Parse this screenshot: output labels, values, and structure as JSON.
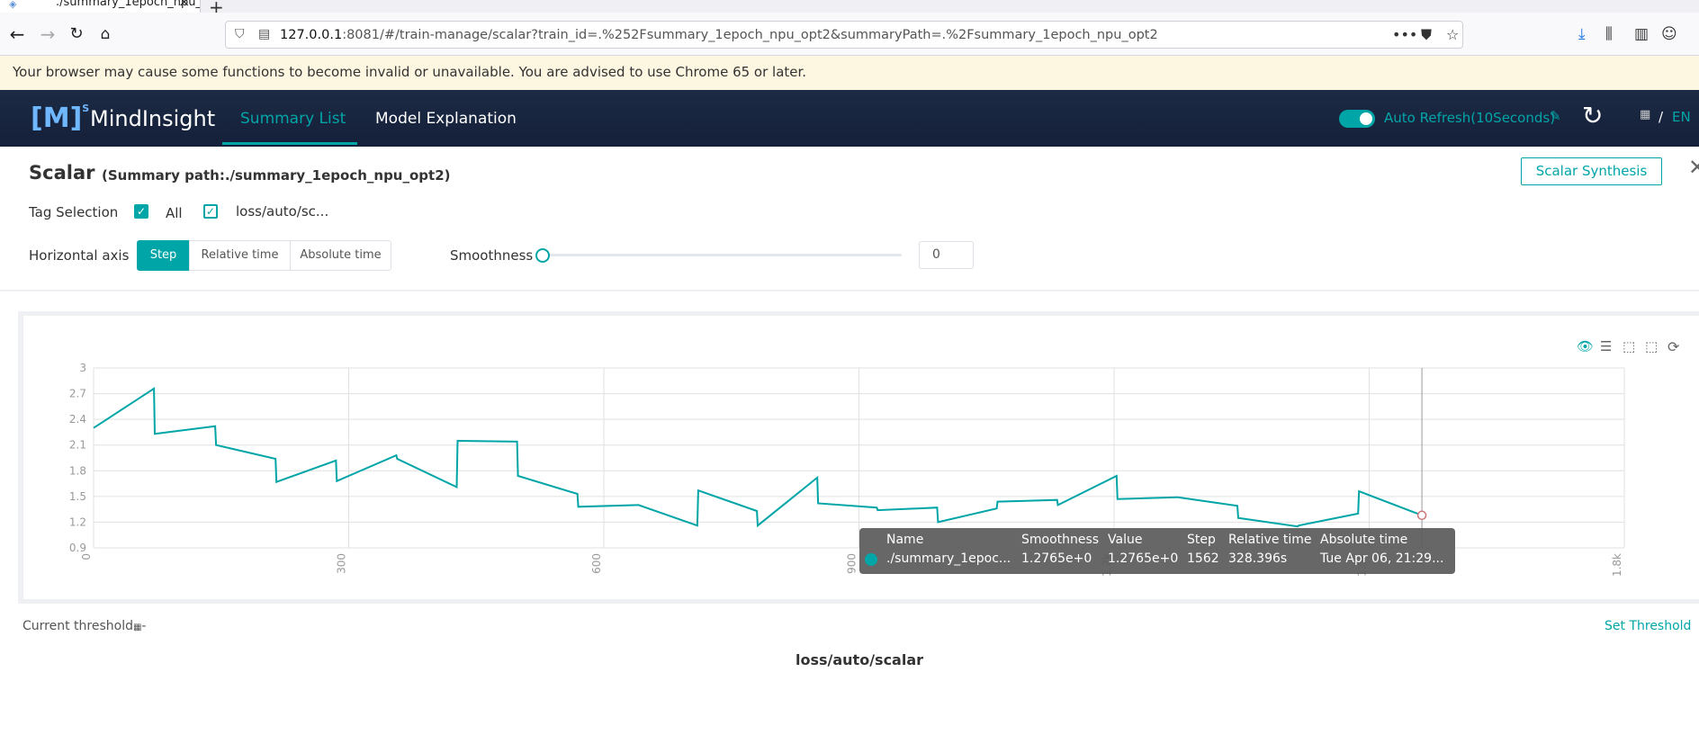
{
  "browser": {
    "tab_title": "./summary_1epoch_npu_...",
    "url_host": "127.0.0.1",
    "url_rest": ":8081/#/train-manage/scalar?train_id=.%252Fsummary_1epoch_npu_opt2&summaryPath=.%2Fsummary_1epoch_npu_opt2",
    "warning": "Your browser may cause some functions to become invalid or unavailable. You are advised to use Chrome 65 or later."
  },
  "header": {
    "logo_mark": "[M]",
    "logo_sup": "S",
    "logo_text": "MindInsight",
    "nav": [
      "Summary List",
      "Model Explanation"
    ],
    "auto_refresh": "Auto Refresh(10Seconds)",
    "lang": "EN",
    "lang_sep": "/"
  },
  "scalar": {
    "title": "Scalar",
    "summary_path": "(Summary path:./summary_1epoch_npu_opt2)",
    "synthesis_button": "Scalar Synthesis",
    "tag_selection_label": "Tag Selection",
    "tag_all": "All",
    "tag_item": "loss/auto/sc...",
    "horizontal_axis_label": "Horizontal axis",
    "axis_options": [
      "Step",
      "Relative time",
      "Absolute time"
    ],
    "selected_axis": "Step",
    "smoothness_label": "Smoothness",
    "smoothness_value": "0",
    "threshold_label": "Current threshold",
    "threshold_value": "-",
    "set_threshold": "Set Threshold",
    "chart_tag": "loss/auto/scalar"
  },
  "tooltip": {
    "headers": [
      "Name",
      "Smoothness",
      "Value",
      "Step",
      "Relative time",
      "Absolute time"
    ],
    "row": [
      "./summary_1epoc...",
      "1.2765e+0",
      "1.2765e+0",
      "1562",
      "328.396s",
      "Tue Apr 06, 21:29..."
    ]
  },
  "chart_data": {
    "type": "line",
    "xlabel": "",
    "ylabel": "",
    "xlim": [
      0,
      1800
    ],
    "ylim": [
      0.9,
      3
    ],
    "x_ticks": [
      "0",
      "300",
      "600",
      "900",
      "1.2k",
      "1.5k",
      "1.8k"
    ],
    "y_ticks": [
      "0.9",
      "1.2",
      "1.5",
      "1.8",
      "2.1",
      "2.4",
      "2.7",
      "3"
    ],
    "line_color": "#00a5a7",
    "series": [
      {
        "x": [
          0,
          71,
          72,
          143,
          144,
          214,
          215,
          285,
          286,
          356,
          357,
          427,
          428,
          498,
          499,
          569,
          570,
          640,
          641,
          710,
          711,
          780,
          781,
          851,
          852,
          921,
          922,
          992,
          993,
          1062,
          1063,
          1133,
          1134,
          1203,
          1204,
          1274,
          1275,
          1345,
          1346,
          1416,
          1417,
          1487,
          1488,
          1562
        ],
        "y": [
          2.3,
          2.76,
          2.23,
          2.32,
          2.1,
          1.94,
          1.67,
          1.92,
          1.68,
          1.98,
          1.94,
          1.61,
          2.15,
          2.14,
          1.74,
          1.53,
          1.38,
          1.4,
          1.4,
          1.16,
          1.57,
          1.33,
          1.16,
          1.72,
          1.42,
          1.37,
          1.34,
          1.37,
          1.2,
          1.36,
          1.44,
          1.46,
          1.4,
          1.74,
          1.47,
          1.49,
          1.49,
          1.39,
          1.25,
          1.15,
          1.16,
          1.3,
          1.56,
          1.28
        ]
      }
    ],
    "hover_step": 1562
  }
}
